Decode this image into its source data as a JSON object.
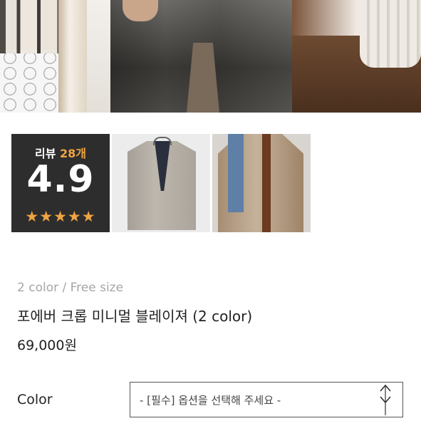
{
  "hero": {
    "icon": "product-photo-jeans"
  },
  "thumbnails": [
    {
      "review_label": "리뷰",
      "review_count": "28개",
      "rating": "4.9",
      "stars": "★★★★★"
    },
    {
      "icon": "gray-blazer-photo"
    },
    {
      "icon": "model-wearing-blazer-photo"
    }
  ],
  "product": {
    "options_summary": "2 color / Free size",
    "title": "포에버 크롭 미니멀 블레이져 (2 color)",
    "price": "69,000원"
  },
  "color_option": {
    "label": "Color",
    "placeholder": "- [필수] 옵션을 선택해 주세요 -"
  },
  "colors": {
    "accent_orange": "#f0a442",
    "text_gray": "#a6a6a6"
  }
}
